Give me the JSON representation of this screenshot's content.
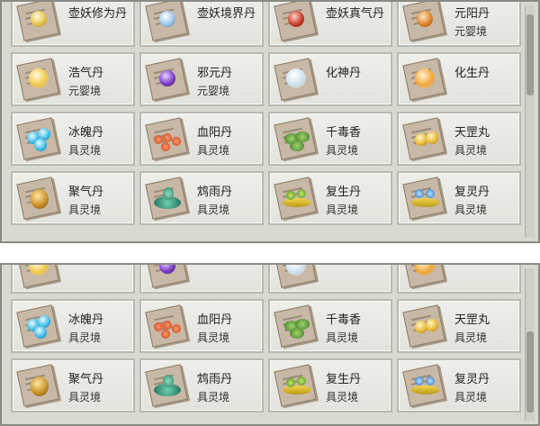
{
  "top_panel": {
    "rows": [
      [
        {
          "name": "壶妖修为丹",
          "realm": "",
          "pill": "pill-gold-white"
        },
        {
          "name": "壶妖境界丹",
          "realm": "",
          "pill": "pill-blue-white"
        },
        {
          "name": "壶妖真气丹",
          "realm": "",
          "pill": "pill-red"
        },
        {
          "name": "元阳丹",
          "realm": "元婴境",
          "pill": "pill-orange"
        }
      ],
      [
        {
          "name": "浩气丹",
          "realm": "元婴境",
          "pill": "pill-gold-glow"
        },
        {
          "name": "邪元丹",
          "realm": "元婴境",
          "pill": "pill-purple"
        },
        {
          "name": "化神丹",
          "realm": "",
          "pill": "pill-white-glow"
        },
        {
          "name": "化生丹",
          "realm": "",
          "pill": "pill-orange-glow"
        }
      ],
      [
        {
          "name": "冰魄丹",
          "realm": "具灵境",
          "pill": "pill-ice"
        },
        {
          "name": "血阳丹",
          "realm": "具灵境",
          "pill": "pill-red-cluster"
        },
        {
          "name": "千毒香",
          "realm": "具灵境",
          "pill": "pill-green-herb"
        },
        {
          "name": "天罡丸",
          "realm": "具灵境",
          "pill": "pill-gold-pair"
        }
      ],
      [
        {
          "name": "聚气丹",
          "realm": "具灵境",
          "pill": "pill-gold-jar"
        },
        {
          "name": "鸩雨丹",
          "realm": "具灵境",
          "pill": "pill-teal-plant"
        },
        {
          "name": "复生丹",
          "realm": "具灵境",
          "pill": "pill-yellow-green"
        },
        {
          "name": "复灵丹",
          "realm": "具灵境",
          "pill": "pill-blue-gold"
        }
      ]
    ]
  },
  "bottom_panel": {
    "rows": [
      [
        {
          "name": "",
          "realm": "",
          "pill": "pill-gold-glow"
        },
        {
          "name": "",
          "realm": "",
          "pill": "pill-purple"
        },
        {
          "name": "",
          "realm": "",
          "pill": "pill-white-glow"
        },
        {
          "name": "",
          "realm": "",
          "pill": "pill-orange-glow"
        }
      ],
      [
        {
          "name": "冰魄丹",
          "realm": "具灵境",
          "pill": "pill-ice"
        },
        {
          "name": "血阳丹",
          "realm": "具灵境",
          "pill": "pill-red-cluster"
        },
        {
          "name": "千毒香",
          "realm": "具灵境",
          "pill": "pill-green-herb"
        },
        {
          "name": "天罡丸",
          "realm": "具灵境",
          "pill": "pill-gold-pair"
        }
      ],
      [
        {
          "name": "聚气丹",
          "realm": "具灵境",
          "pill": "pill-gold-jar"
        },
        {
          "name": "鸩雨丹",
          "realm": "具灵境",
          "pill": "pill-teal-plant"
        },
        {
          "name": "复生丹",
          "realm": "具灵境",
          "pill": "pill-yellow-green"
        },
        {
          "name": "复灵丹",
          "realm": "具灵境",
          "pill": "pill-blue-gold"
        }
      ]
    ]
  },
  "colors": {
    "panel_bg": "#d9d9d4",
    "card_bg": "#eaeae5",
    "card_border": "#b9b9b2",
    "text": "#222222"
  }
}
